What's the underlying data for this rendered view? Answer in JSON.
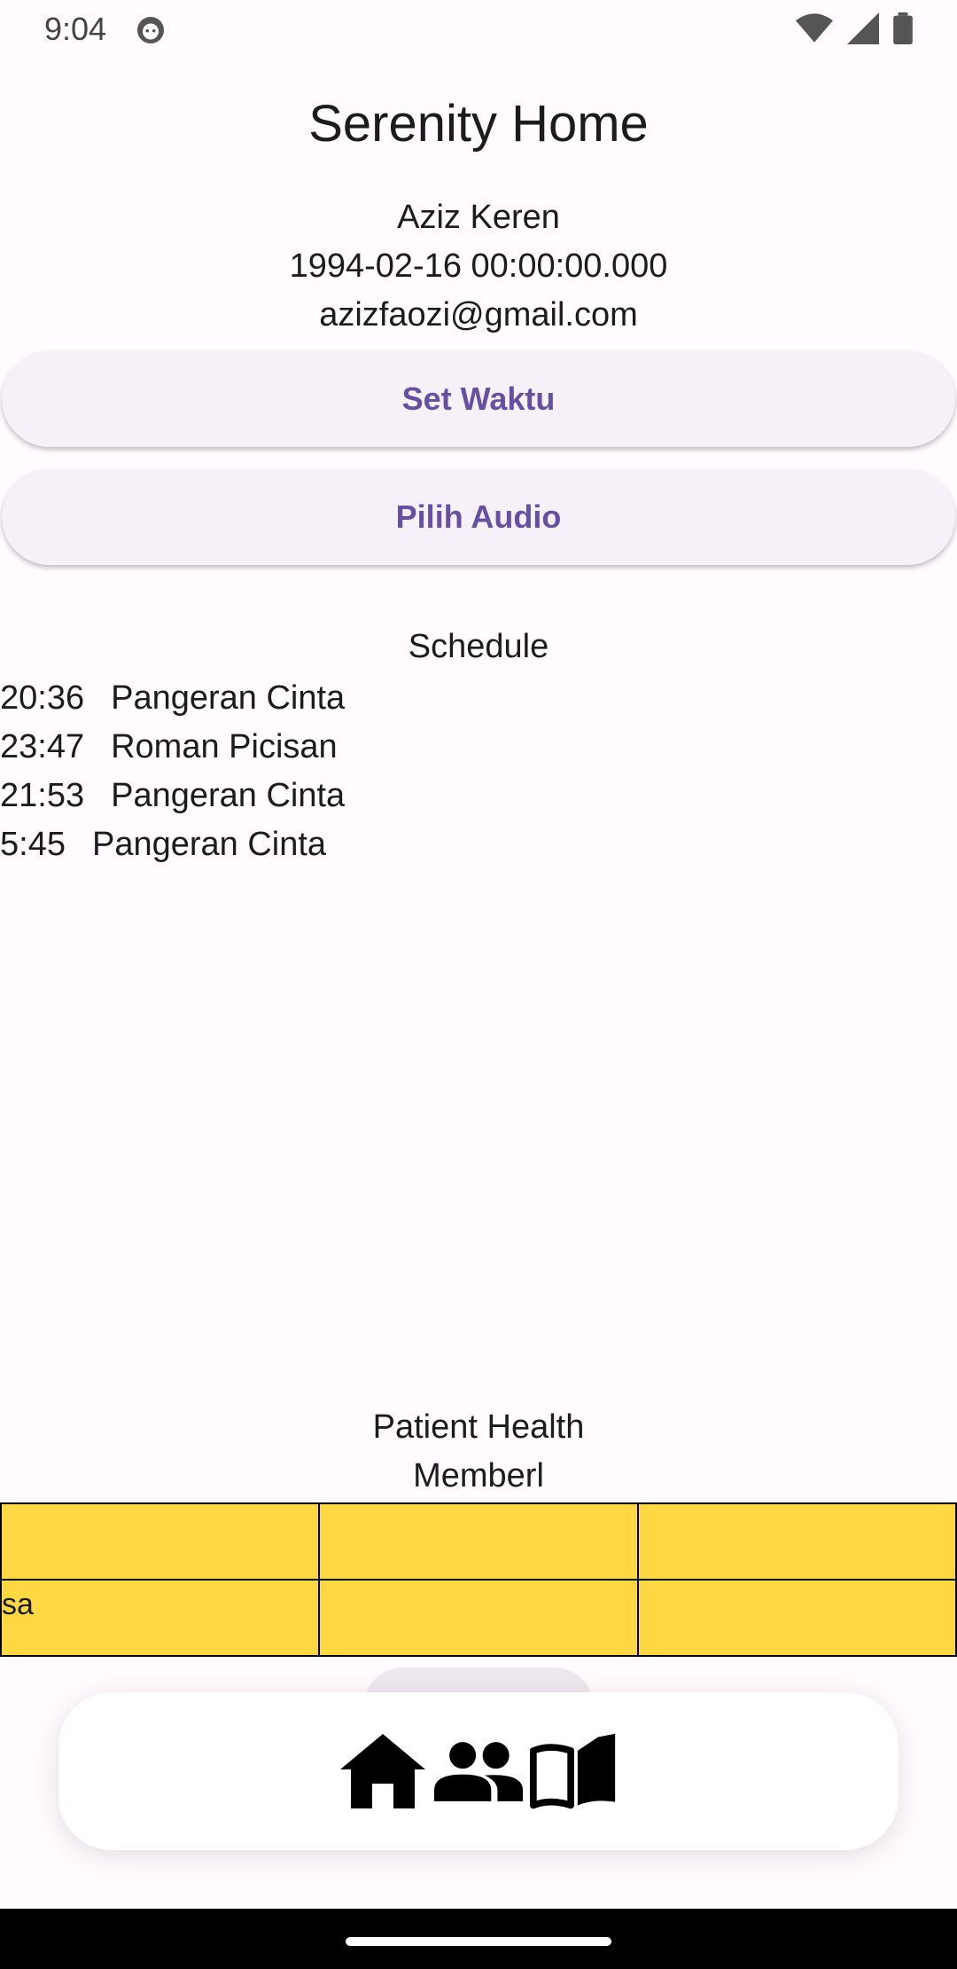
{
  "status_bar": {
    "time": "9:04",
    "icons": [
      "app-notification-icon",
      "wifi-icon",
      "signal-icon",
      "battery-icon"
    ]
  },
  "header": {
    "title": "Serenity Home"
  },
  "profile": {
    "name": "Aziz Keren",
    "birthdate": "1994-02-16 00:00:00.000",
    "email": "azizfaozi@gmail.com"
  },
  "buttons": {
    "set_time": "Set Waktu",
    "choose_audio": "Pilih Audio"
  },
  "schedule": {
    "title": "Schedule",
    "items": [
      {
        "time": "20:36",
        "audio": "Pangeran Cinta"
      },
      {
        "time": "23:47",
        "audio": "Roman Picisan"
      },
      {
        "time": "21:53",
        "audio": "Pangeran Cinta"
      },
      {
        "time": "5:45",
        "audio": "Pangeran Cinta"
      }
    ]
  },
  "health": {
    "title": "Patient Health",
    "subtitle": "Memberl",
    "rows": [
      [
        "",
        "",
        ""
      ],
      [
        "sa",
        "",
        ""
      ]
    ]
  },
  "bottom_nav": {
    "items": [
      "home-icon",
      "people-icon",
      "book-icon"
    ]
  },
  "colors": {
    "accent": "#6750a4",
    "table_fill": "#fdd843",
    "background": "#fffbfe"
  }
}
